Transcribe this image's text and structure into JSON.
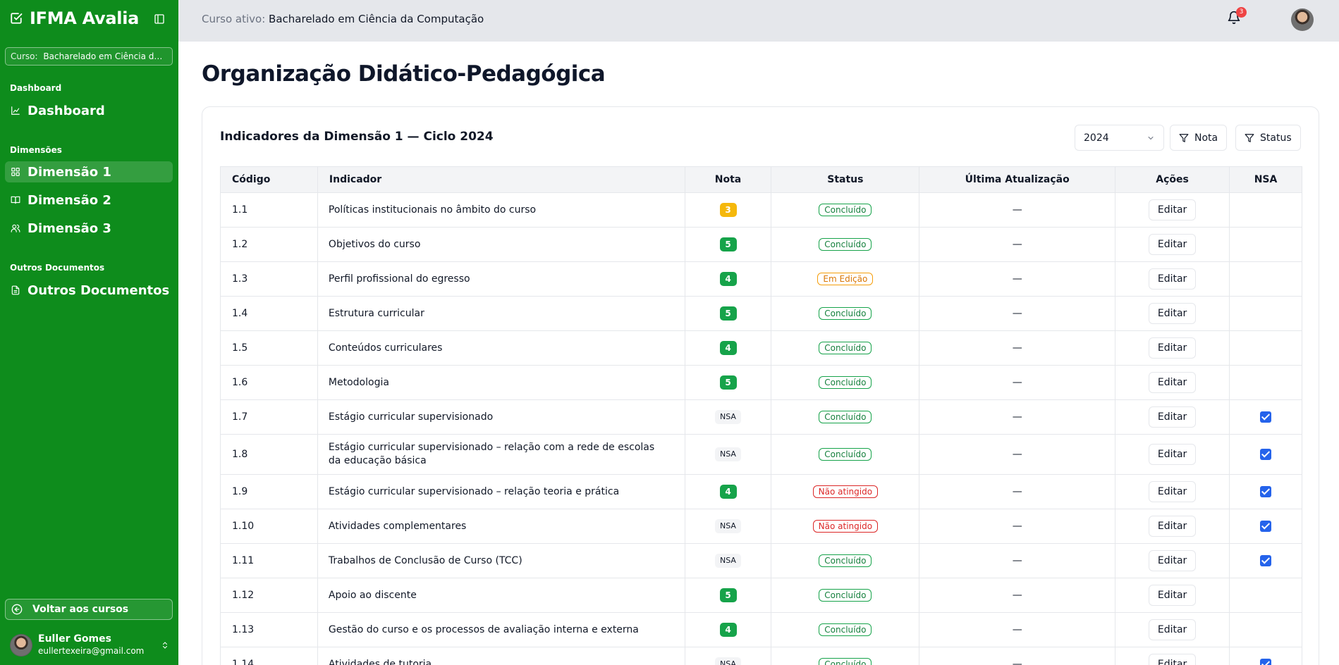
{
  "app": {
    "name": "IFMA Avalia",
    "course_chip_label": "Curso:",
    "course_chip_value": "Bacharelado em Ciência da Computação"
  },
  "sidebar": {
    "groups": [
      {
        "label": "Dashboard",
        "items": [
          {
            "label": "Dashboard",
            "icon": "chart-icon"
          }
        ]
      },
      {
        "label": "Dimensões",
        "items": [
          {
            "label": "Dimensão 1",
            "icon": "grid-icon",
            "active": true
          },
          {
            "label": "Dimensão 2",
            "icon": "book-icon"
          },
          {
            "label": "Dimensão 3",
            "icon": "users-icon"
          }
        ]
      },
      {
        "label": "Outros Documentos",
        "items": [
          {
            "label": "Outros Documentos",
            "icon": "document-icon"
          }
        ]
      }
    ],
    "back_label": "Voltar aos cursos",
    "user": {
      "name": "Euller Gomes",
      "email": "eullertexeira@gmail.com"
    }
  },
  "topbar": {
    "active_course_label": "Curso ativo:",
    "active_course_value": "Bacharelado em Ciência da Computação",
    "notification_count": "3"
  },
  "main": {
    "title": "Organização Didático-Pedagógica",
    "card_title": "Indicadores da Dimensão 1 — Ciclo 2024",
    "year_selected": "2024",
    "filter_nota": "Nota",
    "filter_status": "Status",
    "columns": [
      "Código",
      "Indicador",
      "Nota",
      "Status",
      "Última Atualização",
      "Ações",
      "NSA"
    ],
    "rows": [
      {
        "code": "1.1",
        "indicator": "Políticas institucionais no âmbito do curso",
        "grade": "3",
        "status": "Concluído",
        "updated": "—",
        "action": "Editar",
        "nsa": false
      },
      {
        "code": "1.2",
        "indicator": "Objetivos do curso",
        "grade": "5",
        "status": "Concluído",
        "updated": "—",
        "action": "Editar",
        "nsa": false
      },
      {
        "code": "1.3",
        "indicator": "Perfil profissional do egresso",
        "grade": "4",
        "status": "Em Edição",
        "updated": "—",
        "action": "Editar",
        "nsa": false
      },
      {
        "code": "1.4",
        "indicator": "Estrutura curricular",
        "grade": "5",
        "status": "Concluído",
        "updated": "—",
        "action": "Editar",
        "nsa": false
      },
      {
        "code": "1.5",
        "indicator": "Conteúdos curriculares",
        "grade": "4",
        "status": "Concluído",
        "updated": "—",
        "action": "Editar",
        "nsa": false
      },
      {
        "code": "1.6",
        "indicator": "Metodologia",
        "grade": "5",
        "status": "Concluído",
        "updated": "—",
        "action": "Editar",
        "nsa": false
      },
      {
        "code": "1.7",
        "indicator": "Estágio curricular supervisionado",
        "grade": "NSA",
        "status": "Concluído",
        "updated": "—",
        "action": "Editar",
        "nsa": true
      },
      {
        "code": "1.8",
        "indicator": "Estágio curricular supervisionado – relação com a rede de escolas da educação básica",
        "grade": "NSA",
        "status": "Concluído",
        "updated": "—",
        "action": "Editar",
        "nsa": true
      },
      {
        "code": "1.9",
        "indicator": "Estágio curricular supervisionado – relação teoria e prática",
        "grade": "4",
        "status": "Não atingido",
        "updated": "—",
        "action": "Editar",
        "nsa": true
      },
      {
        "code": "1.10",
        "indicator": "Atividades complementares",
        "grade": "NSA",
        "status": "Não atingido",
        "updated": "—",
        "action": "Editar",
        "nsa": true
      },
      {
        "code": "1.11",
        "indicator": "Trabalhos de Conclusão de Curso (TCC)",
        "grade": "NSA",
        "status": "Concluído",
        "updated": "—",
        "action": "Editar",
        "nsa": true
      },
      {
        "code": "1.12",
        "indicator": "Apoio ao discente",
        "grade": "5",
        "status": "Concluído",
        "updated": "—",
        "action": "Editar",
        "nsa": false
      },
      {
        "code": "1.13",
        "indicator": "Gestão do curso e os processos de avaliação interna e externa",
        "grade": "4",
        "status": "Concluído",
        "updated": "—",
        "action": "Editar",
        "nsa": false
      },
      {
        "code": "1.14",
        "indicator": "Atividades de tutoria",
        "grade": "NSA",
        "status": "Concluído",
        "updated": "—",
        "action": "Editar",
        "nsa": true
      }
    ]
  },
  "colors": {
    "sidebar_bg": "#0e8c1c",
    "grade_green": "#16a34a",
    "grade_yellow": "#f5b80b",
    "status_fail": "#dc2626",
    "status_edit": "#d97706",
    "checkbox": "#2563eb"
  }
}
